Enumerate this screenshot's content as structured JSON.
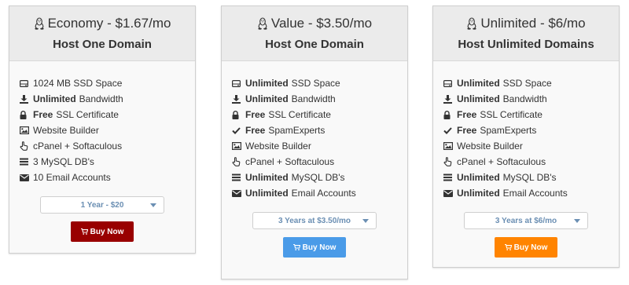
{
  "plans": [
    {
      "name_prefix": "Economy - ",
      "price": "$1.67",
      "price_suffix": "/mo",
      "title": "Host One Domain",
      "features": [
        {
          "icon": "hdd-icon",
          "bold": "",
          "text": "1024 MB SSD Space"
        },
        {
          "icon": "download-icon",
          "bold": "Unlimited",
          "text": "Bandwidth"
        },
        {
          "icon": "lock-icon",
          "bold": "Free",
          "text": "SSL Certificate"
        },
        {
          "icon": "image-icon",
          "bold": "",
          "text": "Website Builder"
        },
        {
          "icon": "hand-pointer-icon",
          "bold": "",
          "text": "cPanel + Softaculous"
        },
        {
          "icon": "list-icon",
          "bold": "",
          "text": "3 MySQL DB's"
        },
        {
          "icon": "envelope-icon",
          "bold": "",
          "text": "10 Email Accounts"
        }
      ],
      "term": "1 Year - $20",
      "buy_label": "Buy Now",
      "buy_color": "#990000"
    },
    {
      "name_prefix": "Value - ",
      "price": "$3.50",
      "price_suffix": "/mo",
      "title": "Host One Domain",
      "features": [
        {
          "icon": "hdd-icon",
          "bold": "Unlimited",
          "text": "SSD Space"
        },
        {
          "icon": "download-icon",
          "bold": "Unlimited",
          "text": "Bandwidth"
        },
        {
          "icon": "lock-icon",
          "bold": "Free",
          "text": "SSL Certificate"
        },
        {
          "icon": "check-icon",
          "bold": "Free",
          "text": "SpamExperts"
        },
        {
          "icon": "image-icon",
          "bold": "",
          "text": "Website Builder"
        },
        {
          "icon": "hand-pointer-icon",
          "bold": "",
          "text": "cPanel + Softaculous"
        },
        {
          "icon": "list-icon",
          "bold": "Unlimited",
          "text": "MySQL DB's"
        },
        {
          "icon": "envelope-icon",
          "bold": "Unlimited",
          "text": "Email Accounts"
        }
      ],
      "term": "3 Years at $3.50/mo",
      "buy_label": "Buy Now",
      "buy_color": "#4a9be8"
    },
    {
      "name_prefix": "Unlimited - ",
      "price": "$6",
      "price_suffix": "/mo",
      "title": "Host Unlimited Domains",
      "features": [
        {
          "icon": "hdd-icon",
          "bold": "Unlimited",
          "text": "SSD Space"
        },
        {
          "icon": "download-icon",
          "bold": "Unlimited",
          "text": "Bandwidth"
        },
        {
          "icon": "lock-icon",
          "bold": "Free",
          "text": "SSL Certificate"
        },
        {
          "icon": "check-icon",
          "bold": "Free",
          "text": "SpamExperts"
        },
        {
          "icon": "image-icon",
          "bold": "",
          "text": "Website Builder"
        },
        {
          "icon": "hand-pointer-icon",
          "bold": "",
          "text": "cPanel + Softaculous"
        },
        {
          "icon": "list-icon",
          "bold": "Unlimited",
          "text": "MySQL DB's"
        },
        {
          "icon": "envelope-icon",
          "bold": "Unlimited",
          "text": "Email Accounts"
        }
      ],
      "term": "3 Years at $6/mo",
      "buy_label": "Buy Now",
      "buy_color": "#ff8400"
    }
  ]
}
